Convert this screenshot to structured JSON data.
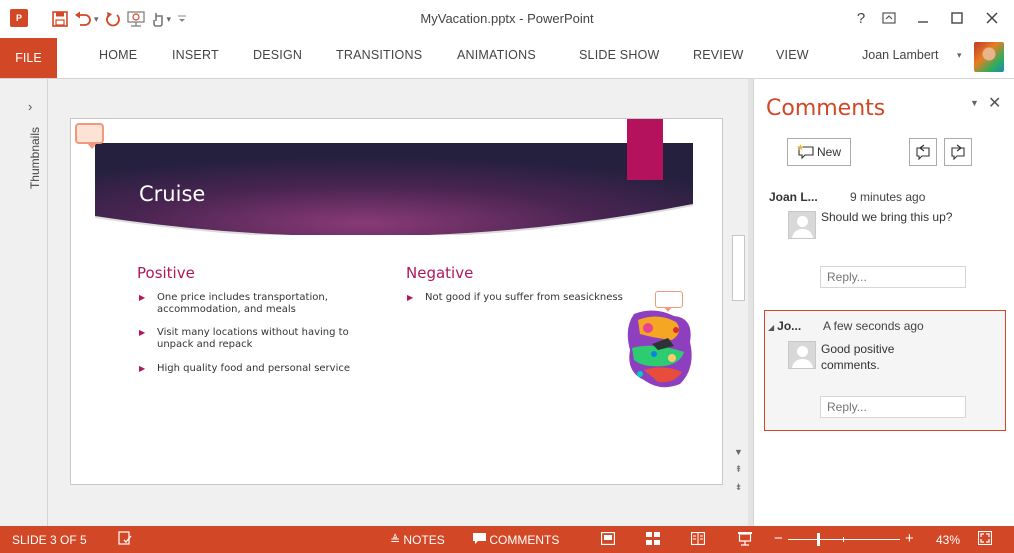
{
  "window": {
    "title": "MyVacation.pptx - PowerPoint",
    "app_icon_label": "P̶",
    "help_glyph": "?",
    "ribbon_display_glyph": "⬜",
    "minimize_glyph": "—",
    "maximize_glyph": "☐",
    "close_glyph": "✕"
  },
  "quick_access": {
    "save_glyph": "💾",
    "undo_glyph": "↶",
    "redo_glyph": "↻",
    "present_glyph": "⧉",
    "touch_glyph": "☝",
    "customize_glyph": "⨪"
  },
  "ribbon": {
    "file_tab": "FILE",
    "tabs": [
      "HOME",
      "INSERT",
      "DESIGN",
      "TRANSITIONS",
      "ANIMATIONS",
      "SLIDE SHOW",
      "REVIEW",
      "VIEW"
    ],
    "user_name": "Joan Lambert"
  },
  "thumbnails": {
    "label": "Thumbnails",
    "expand_glyph": "›"
  },
  "slide": {
    "title": "Cruise",
    "positive_heading": "Positive",
    "negative_heading": "Negative",
    "positive_bullets": [
      "One price includes transportation, accommodation, and meals",
      "Visit many locations without having to unpack and repack",
      "High quality food and personal service"
    ],
    "negative_bullets": [
      "Not good if you suffer from seasickness"
    ],
    "colors": {
      "accent": "#b5125e",
      "heading": "#b0175b",
      "band_dark": "#2a1f4a",
      "band_light": "#7b2f6e"
    }
  },
  "comments_pane": {
    "title": "Comments",
    "new_button": "New",
    "comments": [
      {
        "author": "Joan L...",
        "time": "9 minutes ago",
        "text": "Should we bring this up?",
        "reply_placeholder": "Reply..."
      },
      {
        "author": "Jo...",
        "time": "A few seconds ago",
        "text": "Good positive comments.",
        "reply_placeholder": "Reply..."
      }
    ]
  },
  "statusbar": {
    "slide_indicator": "SLIDE 3 OF 5",
    "notes_label": "NOTES",
    "comments_label": "COMMENTS",
    "zoom_level": "43%",
    "zoom_minus": "−",
    "zoom_plus": "+",
    "color": "#d24726"
  }
}
